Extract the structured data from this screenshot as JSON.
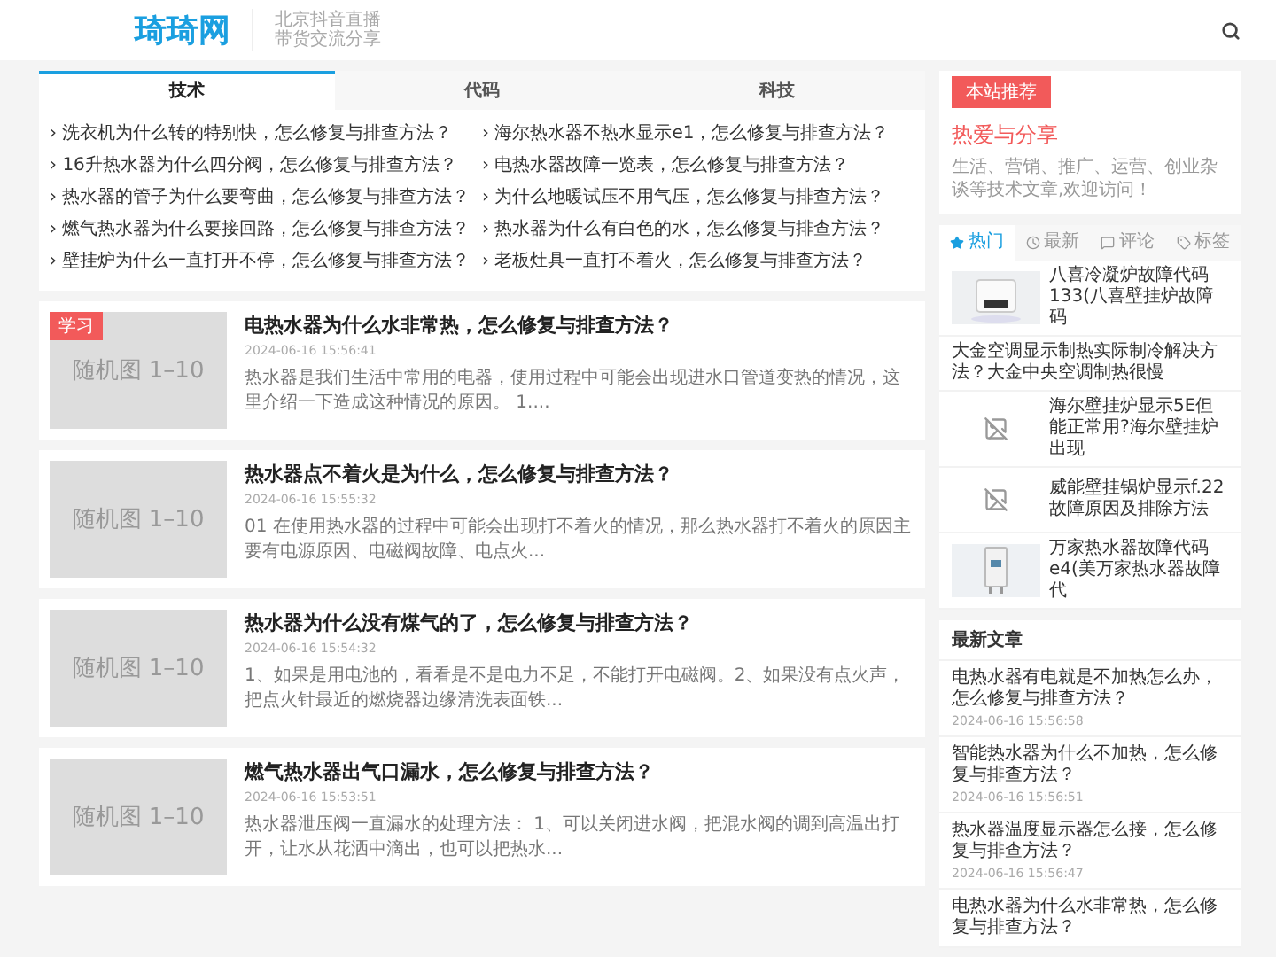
{
  "header": {
    "logo": "琦琦网",
    "tagline": [
      "北京抖音直播",
      "带货交流分享"
    ]
  },
  "topic_box": {
    "tabs": [
      {
        "label": "技术",
        "selected": true
      },
      {
        "label": "代码",
        "selected": false
      },
      {
        "label": "科技",
        "selected": false
      }
    ],
    "bullet": "›",
    "links": [
      "洗衣机为什么转的特别快，怎么修复与排查方法？",
      "海尔热水器不热水显示e1，怎么修复与排查方法？",
      "16升热水器为什么四分阀，怎么修复与排查方法？",
      "电热水器故障一览表，怎么修复与排查方法？",
      "热水器的管子为什么要弯曲，怎么修复与排查方法？",
      "为什么地暖试压不用气压，怎么修复与排查方法？",
      "燃气热水器为什么要接回路，怎么修复与排查方法？",
      "热水器为什么有白色的水，怎么修复与排查方法？",
      "壁挂炉为什么一直打开不停，怎么修复与排查方法？",
      "老板灶具一直打不着火，怎么修复与排查方法？"
    ]
  },
  "posts": [
    {
      "badge": "学习",
      "thumb": "随机图 1–10",
      "title": "电热水器为什么水非常热，怎么修复与排查方法？",
      "date": "2024-06-16 15:56:41",
      "excerpt": "热水器是我们生活中常用的电器，使用过程中可能会出现进水口管道变热的情况，这里介绍一下造成这种情况的原因。 1...."
    },
    {
      "thumb": "随机图 1–10",
      "title": "热水器点不着火是为什么，怎么修复与排查方法？",
      "date": "2024-06-16 15:55:32",
      "excerpt": "01 在使用热水器的过程中可能会出现打不着火的情况，那么热水器打不着火的原因主要有电源原因、电磁阀故障、电点火..."
    },
    {
      "thumb": "随机图 1–10",
      "title": "热水器为什么没有煤气的了，怎么修复与排查方法？",
      "date": "2024-06-16 15:54:32",
      "excerpt": "1、如果是用电池的，看看是不是电力不足，不能打开电磁阀。2、如果没有点火声，把点火针最近的燃烧器边缘清洗表面铁..."
    },
    {
      "thumb": "随机图 1–10",
      "title": "燃气热水器出气口漏水，怎么修复与排查方法？",
      "date": "2024-06-16 15:53:51",
      "excerpt": "热水器泄压阀一直漏水的处理方法： 1、可以关闭进水阀，把混水阀的调到高温出打开，让水从花洒中滴出，也可以把热水..."
    }
  ],
  "recommend": {
    "badge": "本站推荐",
    "title": "热爱与分享",
    "text": "生活、营销、推广、运营、创业杂谈等技术文章,欢迎访问！"
  },
  "side_tabs": {
    "tabs": [
      {
        "label": "热门",
        "kind": "star",
        "selected": true
      },
      {
        "label": "最新",
        "kind": "clock",
        "selected": false
      },
      {
        "label": "评论",
        "kind": "comment",
        "selected": false
      },
      {
        "label": "标签",
        "kind": "tag",
        "selected": false
      }
    ],
    "items": [
      {
        "title": "八喜冷凝炉故障代码133(八喜壁挂炉故障码"
      },
      {
        "kind": "text",
        "title": "大金空调显示制热实际制冷解决方法？大金中央空调制热很慢"
      },
      {
        "kind": "broken",
        "title": "海尔壁挂炉显示5E但能正常用?海尔壁挂炉出现"
      },
      {
        "kind": "broken",
        "title": "威能壁挂锅炉显示f.22故障原因及排除方法"
      },
      {
        "kind": "heater",
        "title": "万家热水器故障代码e4(美万家热水器故障代"
      }
    ]
  },
  "latest": {
    "heading": "最新文章",
    "items": [
      {
        "title": "电热水器有电就是不加热怎么办，怎么修复与排查方法？",
        "date": "2024-06-16 15:56:58"
      },
      {
        "title": "智能热水器为什么不加热，怎么修复与排查方法？",
        "date": "2024-06-16 15:56:51"
      },
      {
        "title": "热水器温度显示器怎么接，怎么修复与排查方法？",
        "date": "2024-06-16 15:56:47"
      },
      {
        "title": "电热水器为什么水非常热，怎么修复与排查方法？"
      }
    ]
  }
}
